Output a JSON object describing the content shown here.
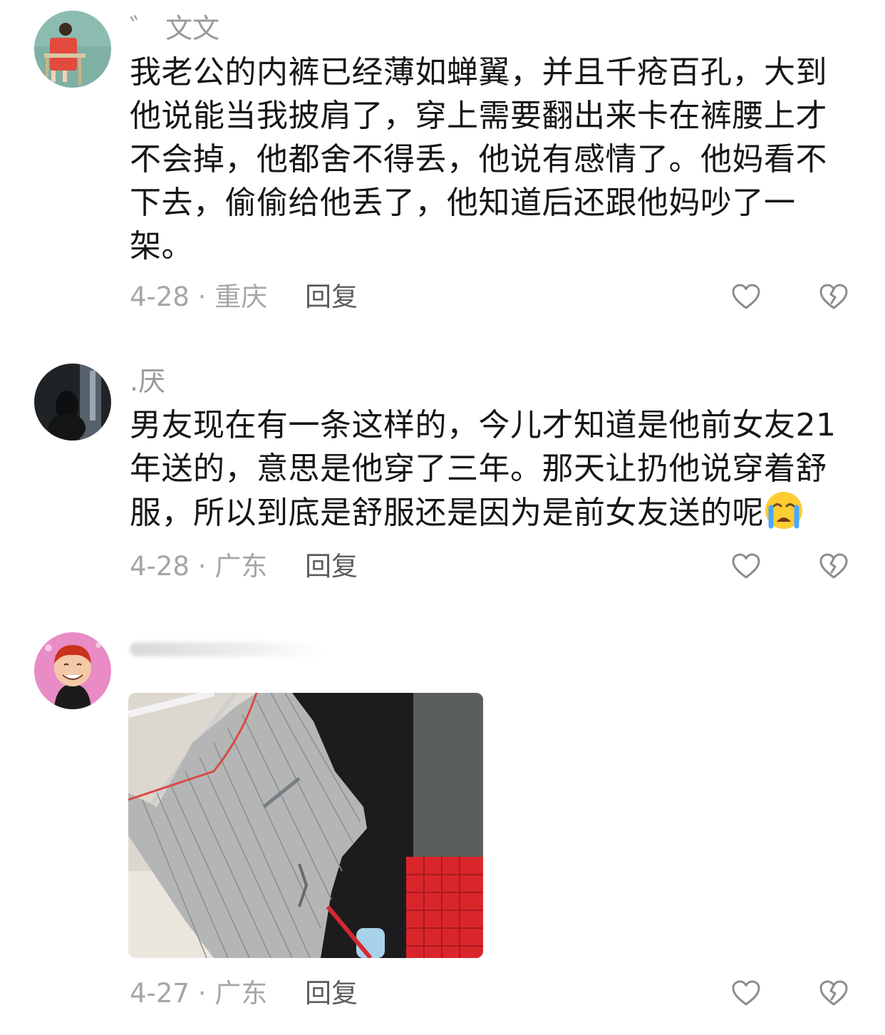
{
  "comments": [
    {
      "username": "゛ 文文",
      "text": "我老公的内裤已经薄如蝉翼，并且千疮百孔，大到他说能当我披肩了，穿上需要翻出来卡在裤腰上才不会掉，他都舍不得丢，他说有感情了。他妈看不下去，偷偷给他丢了，他知道后还跟他妈吵了一架。",
      "meta": "4-28 · 重庆",
      "reply": "回复"
    },
    {
      "username": ".厌",
      "text": "男友现在有一条这样的，今儿才知道是他前女友21年送的，意思是他穿了三年。那天让扔他说穿着舒服，所以到底是舒服还是因为是前女友送的呢",
      "emoji": "crying-face-emoji",
      "meta": "4-28 · 广东",
      "reply": "回复"
    },
    {
      "username": "",
      "image": "photo-of-worn-striped-underwear",
      "meta": "4-27 · 广东",
      "reply": "回复"
    }
  ],
  "icons": {
    "like": "heart-outline-icon",
    "dislike": "broken-heart-icon"
  },
  "colors": {
    "text": "#161616",
    "muted": "#9a9a9a",
    "reply": "#5c5c5c",
    "icon": "#8c8c8c"
  }
}
